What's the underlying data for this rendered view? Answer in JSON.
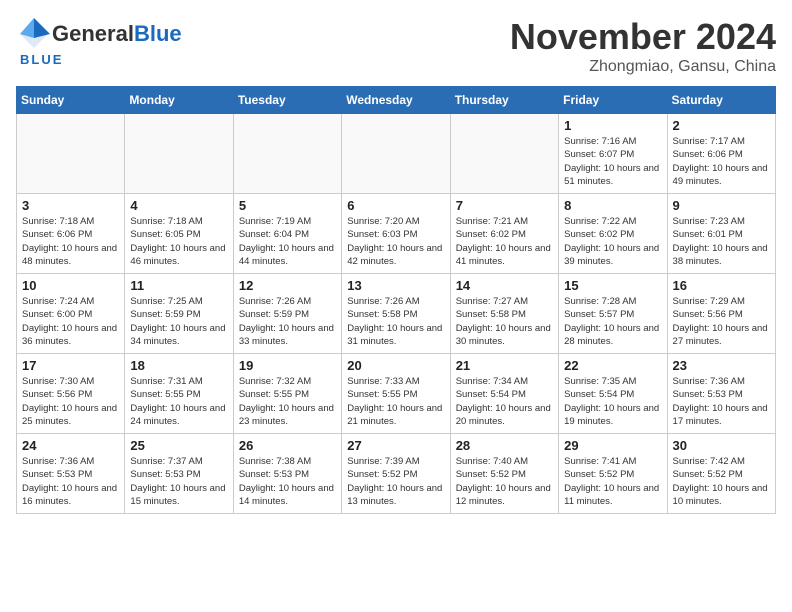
{
  "header": {
    "logo_general": "General",
    "logo_blue": "Blue",
    "title": "November 2024",
    "location": "Zhongmiao, Gansu, China"
  },
  "weekdays": [
    "Sunday",
    "Monday",
    "Tuesday",
    "Wednesday",
    "Thursday",
    "Friday",
    "Saturday"
  ],
  "weeks": [
    [
      {
        "day": "",
        "info": ""
      },
      {
        "day": "",
        "info": ""
      },
      {
        "day": "",
        "info": ""
      },
      {
        "day": "",
        "info": ""
      },
      {
        "day": "",
        "info": ""
      },
      {
        "day": "1",
        "info": "Sunrise: 7:16 AM\nSunset: 6:07 PM\nDaylight: 10 hours\nand 51 minutes."
      },
      {
        "day": "2",
        "info": "Sunrise: 7:17 AM\nSunset: 6:06 PM\nDaylight: 10 hours\nand 49 minutes."
      }
    ],
    [
      {
        "day": "3",
        "info": "Sunrise: 7:18 AM\nSunset: 6:06 PM\nDaylight: 10 hours\nand 48 minutes."
      },
      {
        "day": "4",
        "info": "Sunrise: 7:18 AM\nSunset: 6:05 PM\nDaylight: 10 hours\nand 46 minutes."
      },
      {
        "day": "5",
        "info": "Sunrise: 7:19 AM\nSunset: 6:04 PM\nDaylight: 10 hours\nand 44 minutes."
      },
      {
        "day": "6",
        "info": "Sunrise: 7:20 AM\nSunset: 6:03 PM\nDaylight: 10 hours\nand 42 minutes."
      },
      {
        "day": "7",
        "info": "Sunrise: 7:21 AM\nSunset: 6:02 PM\nDaylight: 10 hours\nand 41 minutes."
      },
      {
        "day": "8",
        "info": "Sunrise: 7:22 AM\nSunset: 6:02 PM\nDaylight: 10 hours\nand 39 minutes."
      },
      {
        "day": "9",
        "info": "Sunrise: 7:23 AM\nSunset: 6:01 PM\nDaylight: 10 hours\nand 38 minutes."
      }
    ],
    [
      {
        "day": "10",
        "info": "Sunrise: 7:24 AM\nSunset: 6:00 PM\nDaylight: 10 hours\nand 36 minutes."
      },
      {
        "day": "11",
        "info": "Sunrise: 7:25 AM\nSunset: 5:59 PM\nDaylight: 10 hours\nand 34 minutes."
      },
      {
        "day": "12",
        "info": "Sunrise: 7:26 AM\nSunset: 5:59 PM\nDaylight: 10 hours\nand 33 minutes."
      },
      {
        "day": "13",
        "info": "Sunrise: 7:26 AM\nSunset: 5:58 PM\nDaylight: 10 hours\nand 31 minutes."
      },
      {
        "day": "14",
        "info": "Sunrise: 7:27 AM\nSunset: 5:58 PM\nDaylight: 10 hours\nand 30 minutes."
      },
      {
        "day": "15",
        "info": "Sunrise: 7:28 AM\nSunset: 5:57 PM\nDaylight: 10 hours\nand 28 minutes."
      },
      {
        "day": "16",
        "info": "Sunrise: 7:29 AM\nSunset: 5:56 PM\nDaylight: 10 hours\nand 27 minutes."
      }
    ],
    [
      {
        "day": "17",
        "info": "Sunrise: 7:30 AM\nSunset: 5:56 PM\nDaylight: 10 hours\nand 25 minutes."
      },
      {
        "day": "18",
        "info": "Sunrise: 7:31 AM\nSunset: 5:55 PM\nDaylight: 10 hours\nand 24 minutes."
      },
      {
        "day": "19",
        "info": "Sunrise: 7:32 AM\nSunset: 5:55 PM\nDaylight: 10 hours\nand 23 minutes."
      },
      {
        "day": "20",
        "info": "Sunrise: 7:33 AM\nSunset: 5:55 PM\nDaylight: 10 hours\nand 21 minutes."
      },
      {
        "day": "21",
        "info": "Sunrise: 7:34 AM\nSunset: 5:54 PM\nDaylight: 10 hours\nand 20 minutes."
      },
      {
        "day": "22",
        "info": "Sunrise: 7:35 AM\nSunset: 5:54 PM\nDaylight: 10 hours\nand 19 minutes."
      },
      {
        "day": "23",
        "info": "Sunrise: 7:36 AM\nSunset: 5:53 PM\nDaylight: 10 hours\nand 17 minutes."
      }
    ],
    [
      {
        "day": "24",
        "info": "Sunrise: 7:36 AM\nSunset: 5:53 PM\nDaylight: 10 hours\nand 16 minutes."
      },
      {
        "day": "25",
        "info": "Sunrise: 7:37 AM\nSunset: 5:53 PM\nDaylight: 10 hours\nand 15 minutes."
      },
      {
        "day": "26",
        "info": "Sunrise: 7:38 AM\nSunset: 5:53 PM\nDaylight: 10 hours\nand 14 minutes."
      },
      {
        "day": "27",
        "info": "Sunrise: 7:39 AM\nSunset: 5:52 PM\nDaylight: 10 hours\nand 13 minutes."
      },
      {
        "day": "28",
        "info": "Sunrise: 7:40 AM\nSunset: 5:52 PM\nDaylight: 10 hours\nand 12 minutes."
      },
      {
        "day": "29",
        "info": "Sunrise: 7:41 AM\nSunset: 5:52 PM\nDaylight: 10 hours\nand 11 minutes."
      },
      {
        "day": "30",
        "info": "Sunrise: 7:42 AM\nSunset: 5:52 PM\nDaylight: 10 hours\nand 10 minutes."
      }
    ]
  ]
}
